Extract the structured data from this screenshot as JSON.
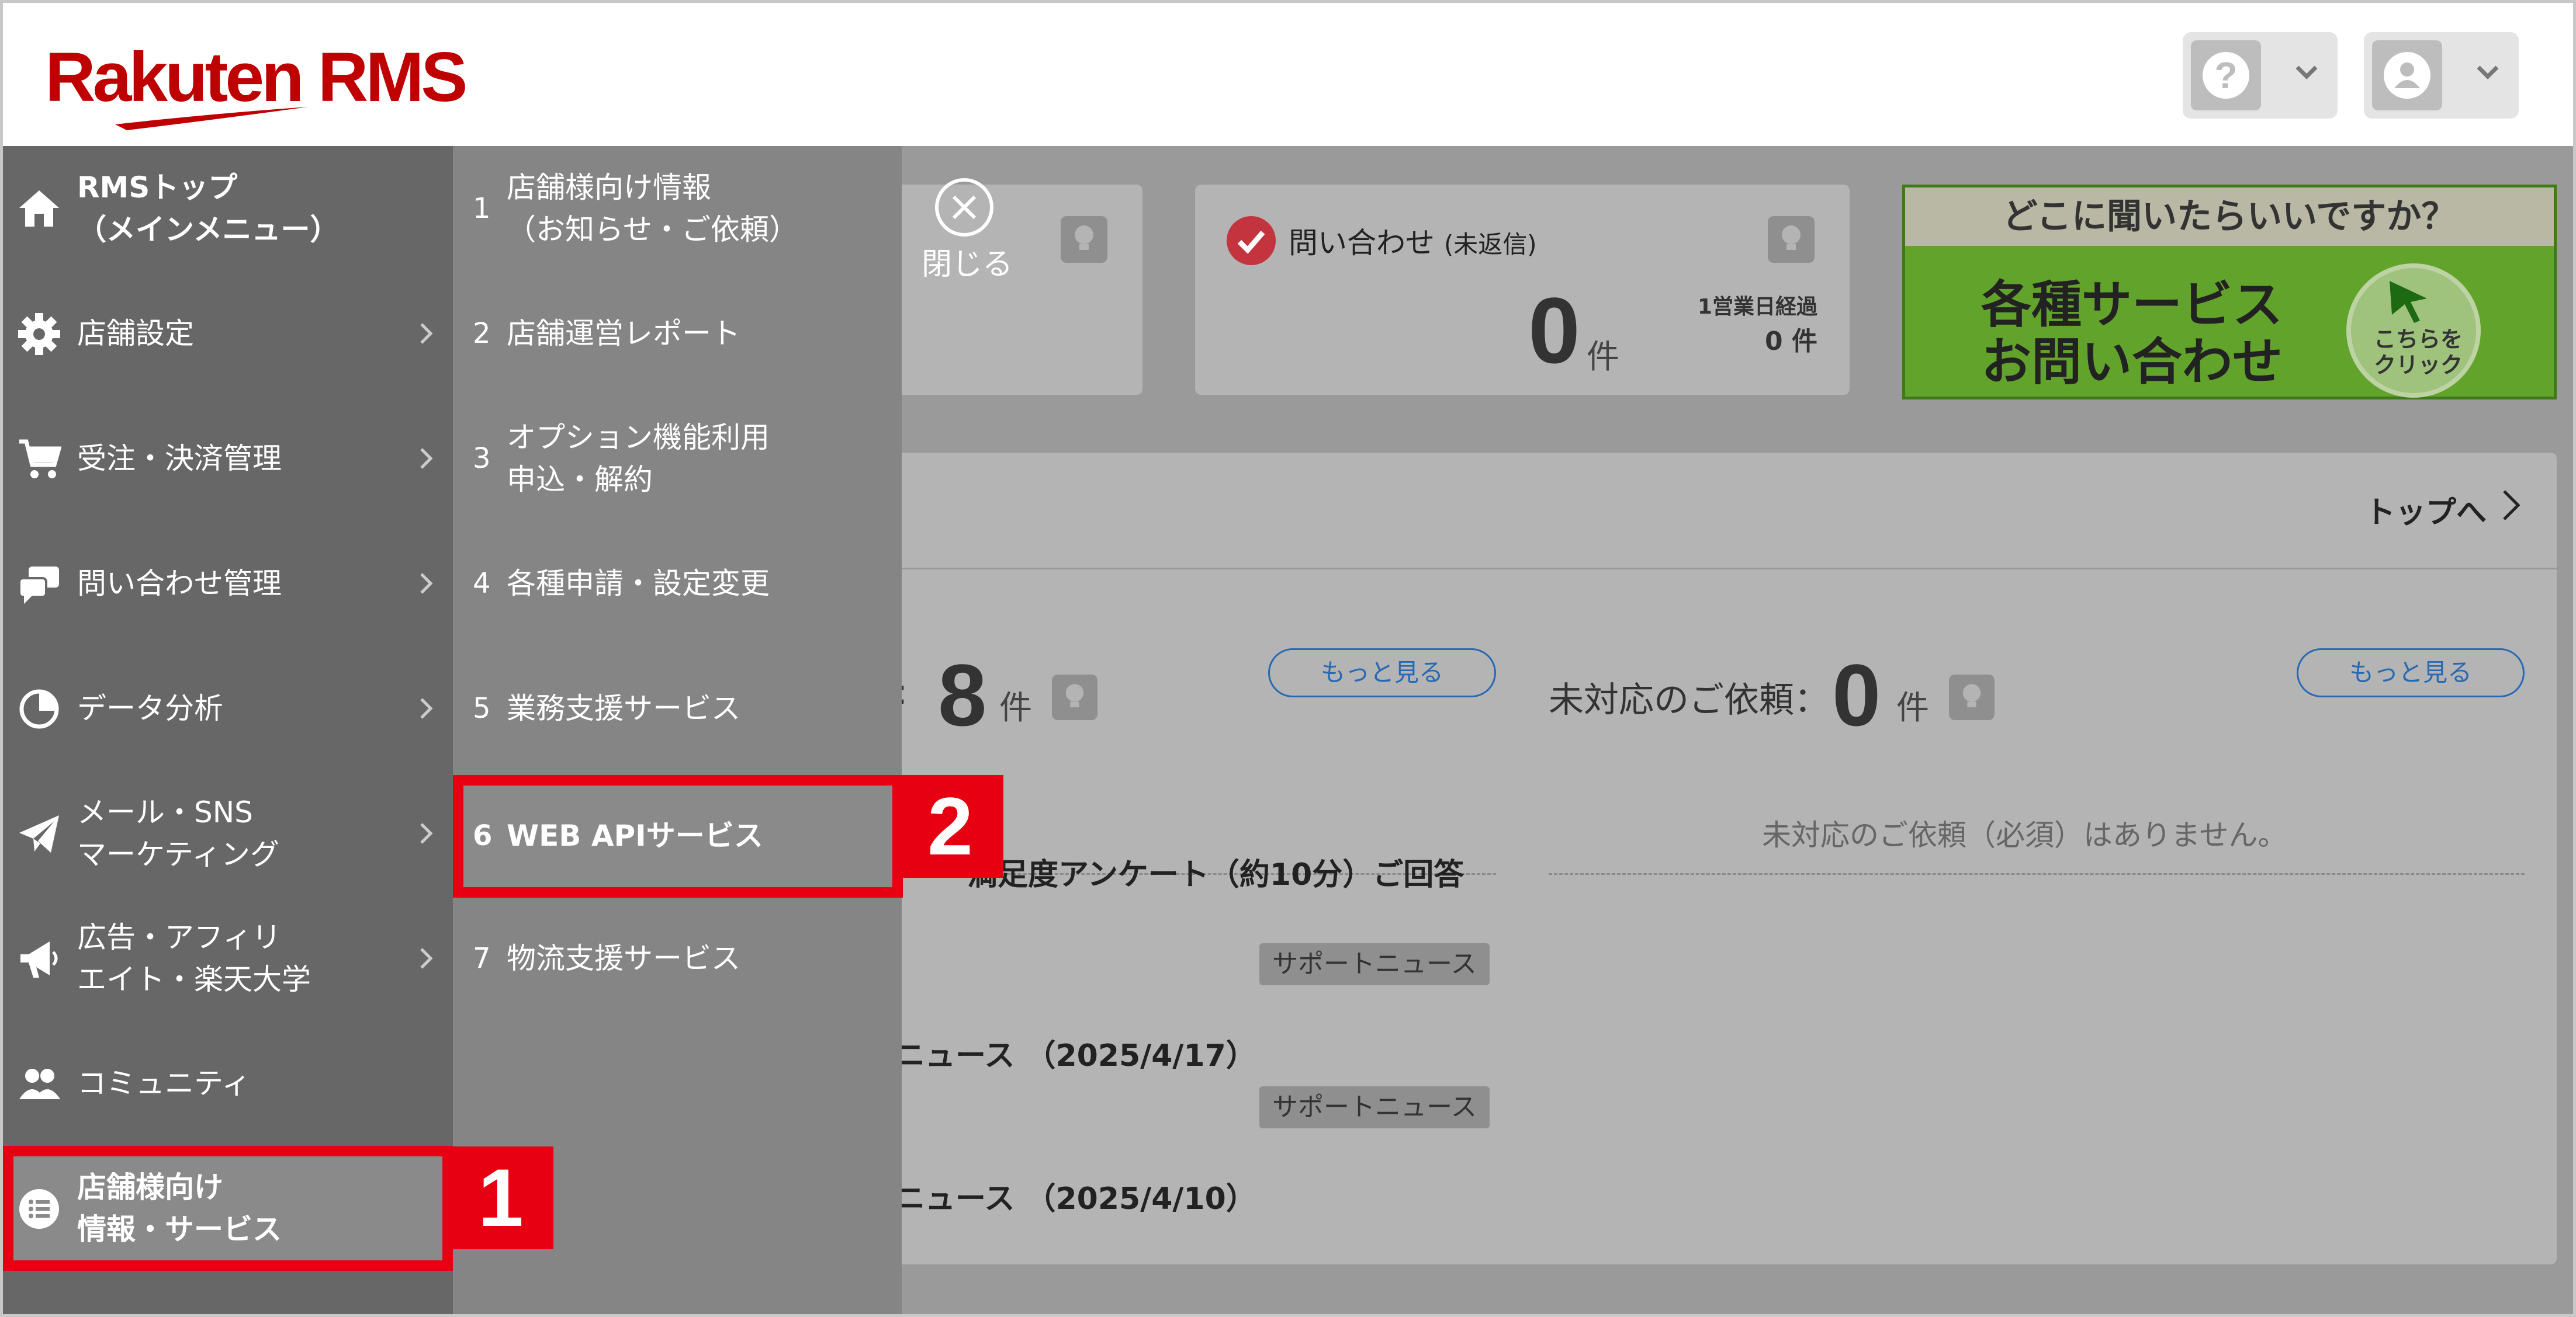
{
  "header": {
    "logo_text": "Rakuten RMS",
    "help_icon_glyph": "?"
  },
  "colors": {
    "brand_red": "#bf0000",
    "highlight_red": "#e60012",
    "link_blue": "#2869b3",
    "banner_green": "#62a32b"
  },
  "close": {
    "label": "閉じる"
  },
  "sidebar": {
    "items": [
      {
        "line1": "RMSトップ",
        "line2": "（メインメニュー）",
        "icon": "home-icon"
      },
      {
        "line1": "店舗設定",
        "icon": "gear-icon"
      },
      {
        "line1": "受注・決済管理",
        "icon": "cart-icon"
      },
      {
        "line1": "問い合わせ管理",
        "icon": "chat-icon"
      },
      {
        "line1": "データ分析",
        "icon": "pie-chart-icon"
      },
      {
        "line1": "メール・SNS",
        "line2": "マーケティング",
        "icon": "paper-plane-icon"
      },
      {
        "line1": "広告・アフィリ",
        "line2": "エイト・楽天大学",
        "icon": "megaphone-icon"
      },
      {
        "line1": "コミュニティ",
        "icon": "people-icon"
      },
      {
        "line1": "店舗様向け",
        "line2": "情報・サービス",
        "icon": "list-icon"
      }
    ]
  },
  "submenu": {
    "items": [
      {
        "num": "1",
        "line1": "店舗様向け情報",
        "line2": "（お知らせ・ご依頼）"
      },
      {
        "num": "2",
        "line1": "店舗運営レポート"
      },
      {
        "num": "3",
        "line1": "オプション機能利用",
        "line2": "申込・解約"
      },
      {
        "num": "4",
        "line1": "各種申請・設定変更"
      },
      {
        "num": "5",
        "line1": "業務支援サービス"
      },
      {
        "num": "6",
        "line1": "WEB APIサービス"
      },
      {
        "num": "7",
        "line1": "物流支援サービス"
      }
    ]
  },
  "steps": {
    "one": "1",
    "two": "2"
  },
  "inquiry_card": {
    "title": "問い合わせ",
    "title_note": "(未返信)",
    "count": "0",
    "unit": "件",
    "sub_label": "1営業日経過",
    "sub_value": "0 件"
  },
  "banner": {
    "top": "どこに聞いたらいいですか？",
    "line1": "各種サービス",
    "line2": "お問い合わせ",
    "click_line1": "こちらを",
    "click_line2": "クリック"
  },
  "panel": {
    "to_top": "トップへ",
    "left_colon": ":",
    "left_count": "8",
    "unit": "件",
    "more": "もっと見る",
    "pending_label": "未対応のご依頼：",
    "pending_count": "0",
    "none_message": "未対応のご依頼（必須）はありません。",
    "survey_text": "満足度アンケート（約10分）ご回答",
    "tag": "サポートニュース",
    "news1": "ニュース （2025/4/17）",
    "news2": "ニュース （2025/4/10）"
  }
}
